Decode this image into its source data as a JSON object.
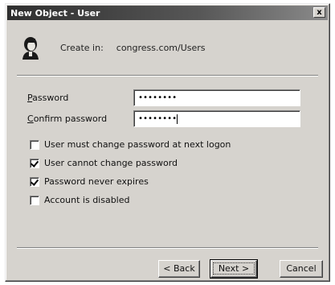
{
  "window": {
    "title": "New Object - User",
    "close_glyph": "x"
  },
  "header": {
    "icon": "user-icon",
    "create_label": "Create in:",
    "create_path": "congress.com/Users"
  },
  "fields": {
    "password_label_hotkey": "P",
    "password_label_rest": "assword",
    "password_value": "••••••••",
    "confirm_label_hotkey": "C",
    "confirm_label_rest": "onfirm password",
    "confirm_value": "••••••••"
  },
  "options": [
    {
      "label": "User must change password at next logon",
      "checked": false
    },
    {
      "label": "User cannot change password",
      "checked": true
    },
    {
      "label": "Password never expires",
      "checked": true
    },
    {
      "label": "Account is disabled",
      "checked": false
    }
  ],
  "buttons": {
    "back": "< Back",
    "next": "Next >",
    "cancel": "Cancel"
  }
}
